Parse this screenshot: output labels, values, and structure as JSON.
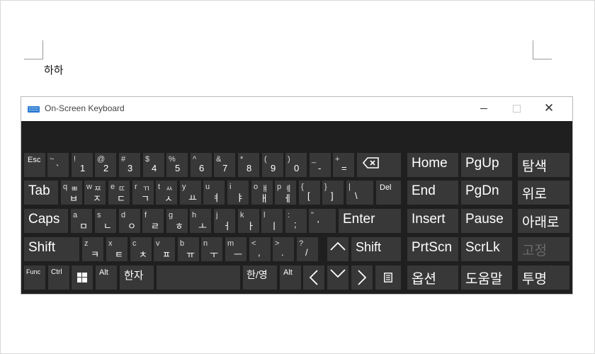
{
  "document": {
    "text": "하하"
  },
  "window": {
    "title": "On-Screen Keyboard",
    "minimize_icon": "minimize-icon",
    "maximize_icon": "maximize-icon",
    "close_glyph": "✕"
  },
  "keys": {
    "esc": "Esc",
    "tilde": {
      "shift": "~",
      "main": "`"
    },
    "n1": {
      "shift": "!",
      "main": "1"
    },
    "n2": {
      "shift": "@",
      "main": "2"
    },
    "n3": {
      "shift": "#",
      "main": "3"
    },
    "n4": {
      "shift": "$",
      "main": "4"
    },
    "n5": {
      "shift": "%",
      "main": "5"
    },
    "n6": {
      "shift": "^",
      "main": "6"
    },
    "n7": {
      "shift": "&",
      "main": "7"
    },
    "n8": {
      "shift": "*",
      "main": "8"
    },
    "n9": {
      "shift": "(",
      "main": "9"
    },
    "n0": {
      "shift": ")",
      "main": "0"
    },
    "minus": {
      "shift": "_",
      "main": "-"
    },
    "equals": {
      "shift": "+",
      "main": "="
    },
    "backspace_icon": "backspace-icon",
    "home": "Home",
    "pgup": "PgUp",
    "search": "탐색",
    "tab": "Tab",
    "q": {
      "shift": "q",
      "main": "ㅂ",
      "top": "ㅃ"
    },
    "w": {
      "shift": "w",
      "main": "ㅈ",
      "top": "ㅉ"
    },
    "e": {
      "shift": "e",
      "main": "ㄷ",
      "top": "ㄸ"
    },
    "r": {
      "shift": "r",
      "main": "ㄱ",
      "top": "ㄲ"
    },
    "t": {
      "shift": "t",
      "main": "ㅅ",
      "top": "ㅆ"
    },
    "y": {
      "shift": "y",
      "main": "ㅛ"
    },
    "u": {
      "shift": "u",
      "main": "ㅕ"
    },
    "i": {
      "shift": "i",
      "main": "ㅑ"
    },
    "o": {
      "shift": "o",
      "main": "ㅐ",
      "top": "ㅒ"
    },
    "p": {
      "shift": "p",
      "main": "ㅔ",
      "top": "ㅖ"
    },
    "lbracket": {
      "shift": "{",
      "main": "["
    },
    "rbracket": {
      "shift": "}",
      "main": "]"
    },
    "backslash": {
      "shift": "|",
      "main": "\\"
    },
    "del": "Del",
    "end": "End",
    "pgdn": "PgDn",
    "up_nav": "위로",
    "caps": "Caps",
    "a": {
      "shift": "a",
      "main": "ㅁ"
    },
    "s": {
      "shift": "s",
      "main": "ㄴ"
    },
    "d": {
      "shift": "d",
      "main": "ㅇ"
    },
    "f": {
      "shift": "f",
      "main": "ㄹ"
    },
    "g": {
      "shift": "g",
      "main": "ㅎ"
    },
    "h": {
      "shift": "h",
      "main": "ㅗ"
    },
    "j": {
      "shift": "j",
      "main": "ㅓ"
    },
    "k": {
      "shift": "k",
      "main": "ㅏ"
    },
    "l": {
      "shift": "l",
      "main": "ㅣ"
    },
    "semicolon": {
      "shift": ":",
      "main": ";"
    },
    "quote": {
      "shift": "\"",
      "main": "'"
    },
    "enter": "Enter",
    "insert": "Insert",
    "pause": "Pause",
    "down_nav": "아래로",
    "shift_l": "Shift",
    "z": {
      "shift": "z",
      "main": "ㅋ"
    },
    "x": {
      "shift": "x",
      "main": "ㅌ"
    },
    "c": {
      "shift": "c",
      "main": "ㅊ"
    },
    "v": {
      "shift": "v",
      "main": "ㅍ"
    },
    "b": {
      "shift": "b",
      "main": "ㅠ"
    },
    "n": {
      "shift": "n",
      "main": "ㅜ"
    },
    "m": {
      "shift": "m",
      "main": "ㅡ"
    },
    "comma": {
      "shift": "<",
      "main": ","
    },
    "period": {
      "shift": ">",
      "main": "."
    },
    "slash": {
      "shift": "?",
      "main": "/"
    },
    "up_arrow_icon": "up-arrow-icon",
    "shift_r": "Shift",
    "prtscn": "PrtScn",
    "scrlk": "ScrLk",
    "fixed": "고정",
    "func": "Func",
    "ctrl": "Ctrl",
    "windows_icon": "windows-icon",
    "alt_l": "Alt",
    "hanja": "한자",
    "space": "",
    "hanyeong": "한/영",
    "alt_r": "Alt",
    "left_arrow_icon": "left-arrow-icon",
    "down_arrow_icon": "down-arrow-icon",
    "right_arrow_icon": "right-arrow-icon",
    "menu_icon": "menu-icon",
    "options": "옵션",
    "help": "도움말",
    "fade": "투명"
  }
}
